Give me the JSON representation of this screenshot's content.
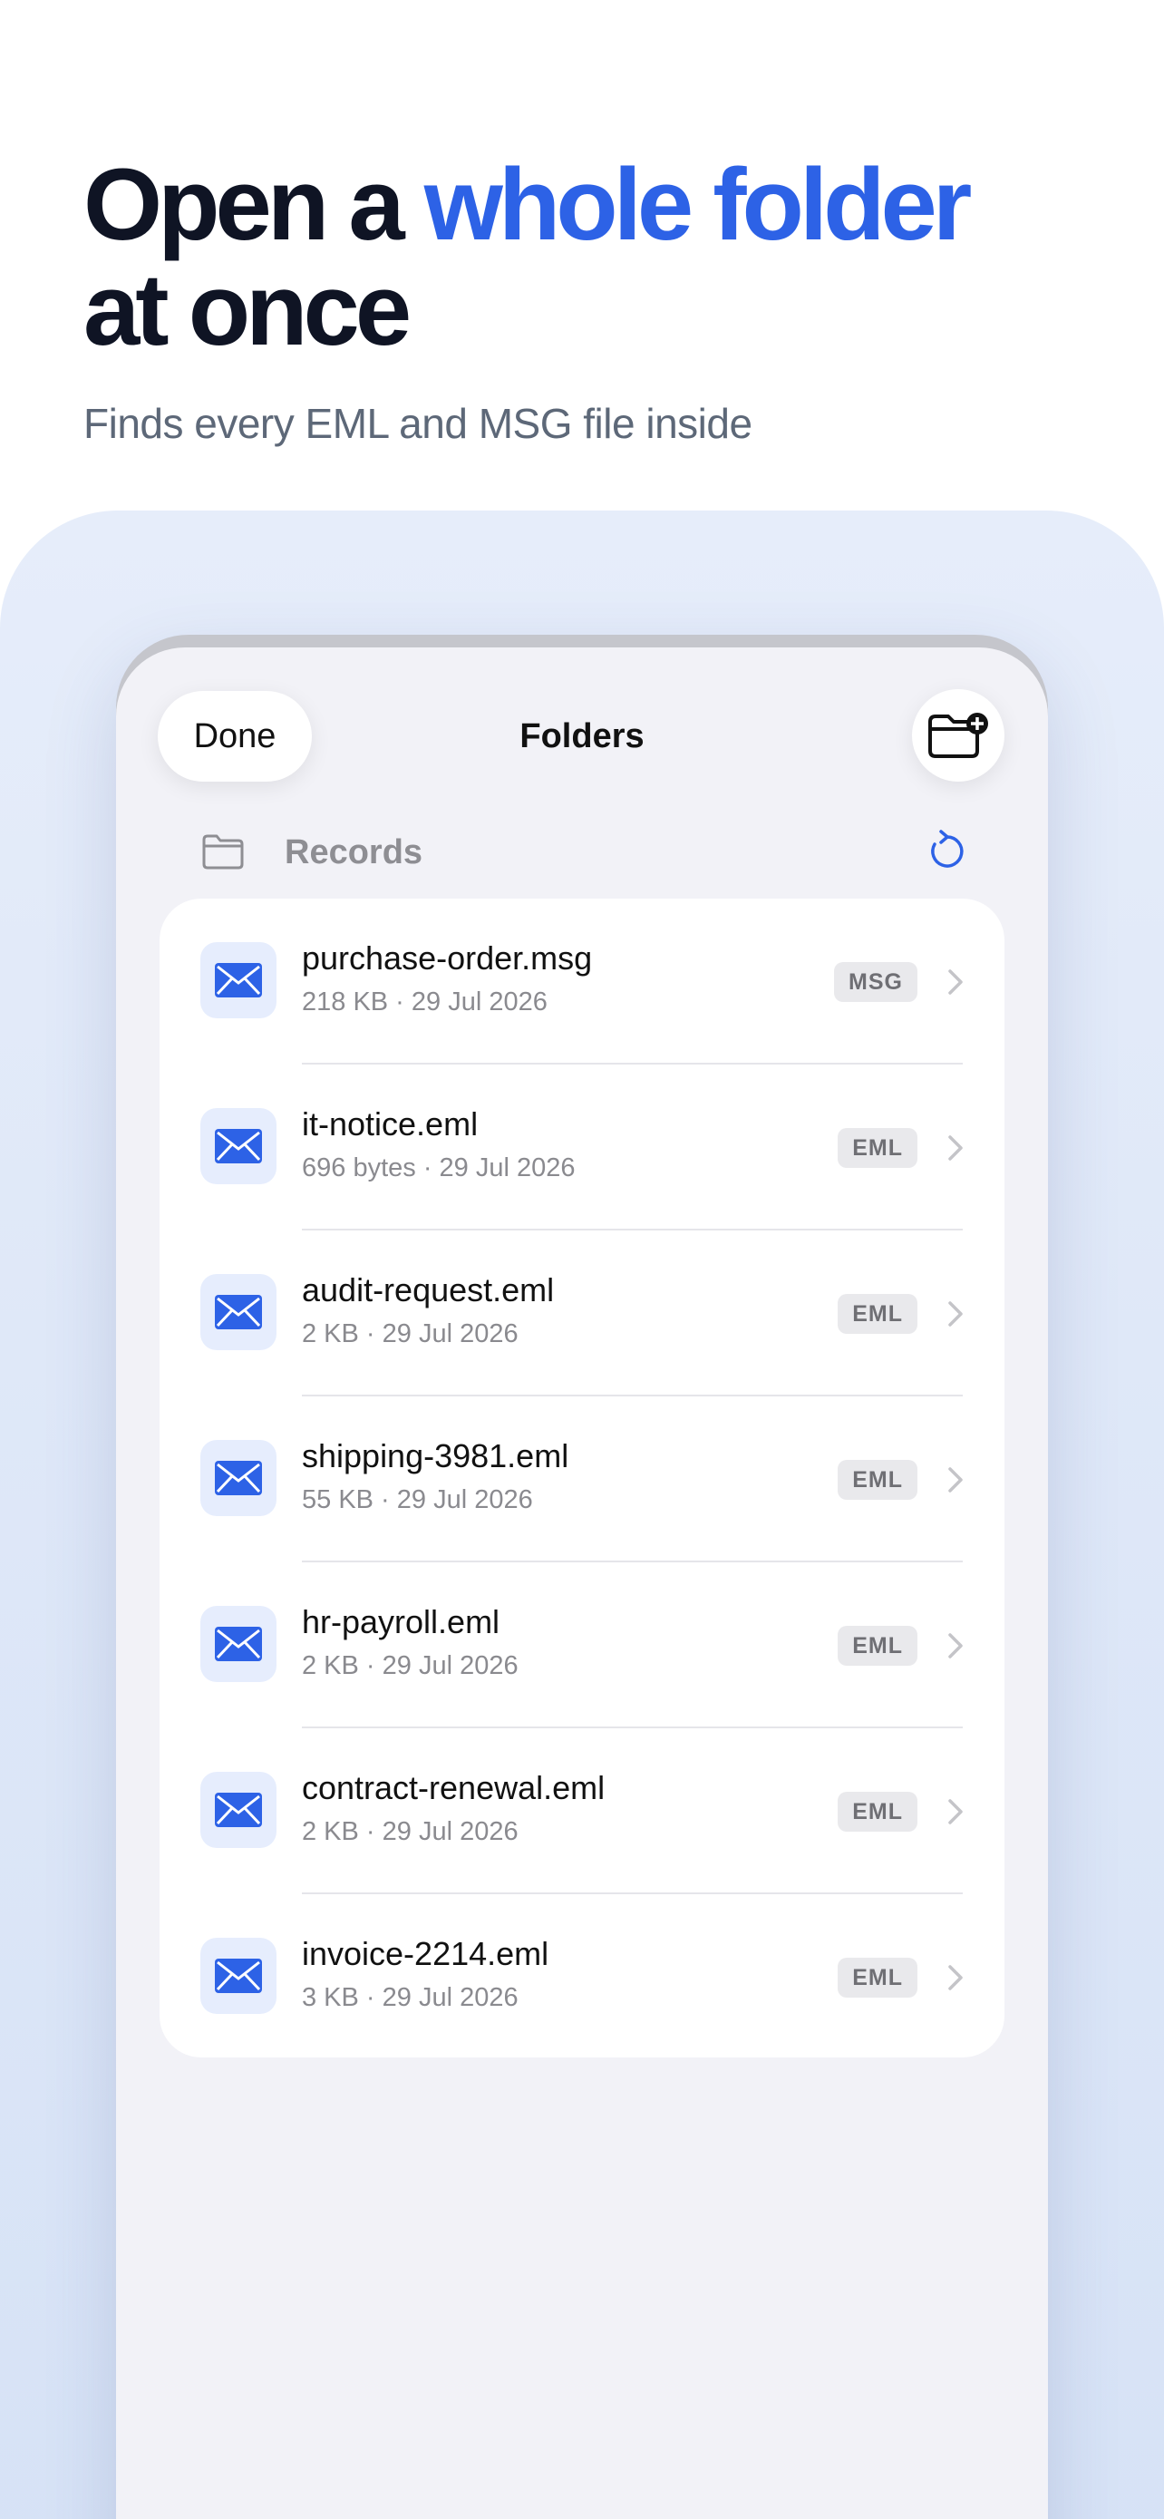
{
  "hero": {
    "headline_part1": "Open a ",
    "headline_accent": "whole folder",
    "headline_part2": "at once",
    "subtitle": "Finds every EML and MSG file inside"
  },
  "nav": {
    "done_label": "Done",
    "title": "Folders",
    "add_icon": "folder-plus-icon"
  },
  "folder": {
    "name": "Records",
    "folder_icon": "folder-icon",
    "refresh_icon": "refresh-icon"
  },
  "colors": {
    "accent": "#2d62e6",
    "headline": "#0f1424"
  },
  "files": [
    {
      "name": "purchase-order.msg",
      "meta": "218 KB · 29 Jul 2026",
      "type": "MSG"
    },
    {
      "name": "it-notice.eml",
      "meta": "696 bytes · 29 Jul 2026",
      "type": "EML"
    },
    {
      "name": "audit-request.eml",
      "meta": "2 KB · 29 Jul 2026",
      "type": "EML"
    },
    {
      "name": "shipping-3981.eml",
      "meta": "55 KB · 29 Jul 2026",
      "type": "EML"
    },
    {
      "name": "hr-payroll.eml",
      "meta": "2 KB · 29 Jul 2026",
      "type": "EML"
    },
    {
      "name": "contract-renewal.eml",
      "meta": "2 KB · 29 Jul 2026",
      "type": "EML"
    },
    {
      "name": "invoice-2214.eml",
      "meta": "3 KB · 29 Jul 2026",
      "type": "EML"
    }
  ]
}
